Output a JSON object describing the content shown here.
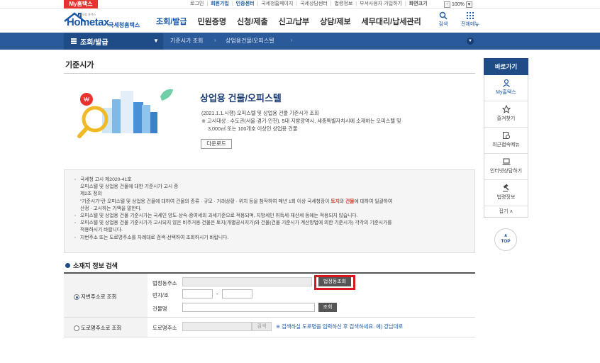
{
  "util": {
    "myhome": "My홈택스",
    "links": [
      {
        "label": "로그인",
        "highlight": false
      },
      {
        "label": "회원가입",
        "highlight": true
      },
      {
        "label": "인증센터",
        "highlight": true
      },
      {
        "label": "국세청홈페이지",
        "highlight": false
      },
      {
        "label": "국세상담센터",
        "highlight": false
      },
      {
        "label": "법령정보",
        "highlight": false
      },
      {
        "label": "부서사용자 가입하기",
        "highlight": false
      },
      {
        "label": "화면크기",
        "highlight": false
      }
    ],
    "zoom": "100%"
  },
  "header": {
    "logo_text": "Hometax",
    "logo_sub": "국세청홈택스",
    "logo_tiny": "국세청 홈택스",
    "gnb": [
      "조회/발급",
      "민원증명",
      "신청/제출",
      "신고/납부",
      "상담/제보",
      "세무대리/납세관리"
    ],
    "icons": [
      {
        "name": "search-icon",
        "label": "검색"
      },
      {
        "name": "all-menu-icon",
        "label": "전체메뉴"
      }
    ]
  },
  "nav": {
    "section": "조회/발급",
    "crumbs": [
      "기준시가 조회",
      "상업용건물/오피스텔"
    ]
  },
  "page": {
    "title": "기준시가"
  },
  "hero": {
    "title": "상업용 건물/오피스텔",
    "desc_1": "(2021.1.1.시행) 오피스텔 및 상업용 건물 기준시가 조회",
    "desc_2": "※ 고시대상 : 수도권(서울·경기·인천), 5대 지방광역시, 세종특별자치시에 소재하는 오피스텔 및",
    "desc_3": "3,000㎡ 또는 100개호 이상인 상업용 건물",
    "download": "다운로드"
  },
  "notice": {
    "lines": [
      {
        "text": "국세청 고시 제2020-41호",
        "bullet": true
      },
      {
        "text": "오피스텔 및 상업용 건물에 대한 기준시가 고시 중",
        "bullet": false
      },
      {
        "text": "제2조 정의",
        "bullet": false
      },
      {
        "text": "\"기준시가\"란 오피스텔 및 상업용 건물에 대하여 건물의 종류 · 규모 · 거래상황 · 위치 등을 참작하여 매년 1회 이상 국세청장이 토지와 건물에 대하여 일괄하여",
        "bullet": false
      },
      {
        "text": "산정 · 고시하는 가액을 말한다.",
        "bullet": false
      },
      {
        "text": "오피스텔 및 상업용 건물 기준시가는 국세인 양도·상속·증여세의 과세기준으로 적용되며, 지방세인 취득세·재산세 등에는 적용되지 않습니다.",
        "bullet": true
      },
      {
        "text": "오피스텔 및 상업용 건물 기준시가가 고시되지 않은 비주거용 건물은 토지(개별공시지가)와 건물(건물 기준시가 계산방법에 의한 기준시가) 각각의 기준시가를",
        "bullet": true
      },
      {
        "text": "적용하시기 바랍니다.",
        "bullet": false
      },
      {
        "text": "지번주소 또는 도로명주소를 차례대로 검색·선택하여 조회하시기 바랍니다.",
        "bullet": true
      }
    ],
    "kw_land": "토지",
    "kw_building": "건물"
  },
  "search": {
    "section_title": "소재지 정보 검색",
    "radio_jibun": "지번주소로 조회",
    "radio_road": "도로명주소로 조회",
    "label_legal_dong": "법정동주소",
    "label_bunji": "번지/호",
    "label_building": "건물명",
    "label_road": "도로명주소",
    "btn_legal_dong": "법정동조회",
    "btn_query": "조회",
    "btn_search": "검색",
    "dash": "-",
    "hint": "※ 검색하실 도로명을 입력하신 후 검색하세요. 예) 강남대로"
  },
  "quick": {
    "title": "바로가기",
    "items": [
      {
        "icon": "person-icon",
        "label": "My홈택스"
      },
      {
        "icon": "star-icon",
        "label": "즐겨찾기"
      },
      {
        "icon": "recent-menu-icon",
        "label": "최근접속메뉴"
      },
      {
        "icon": "laptop-icon",
        "label": "인터넷상담하기"
      },
      {
        "icon": "gavel-icon",
        "label": "법령정보"
      }
    ],
    "fold": "접기 ∧",
    "top": "TOP"
  },
  "colors": {
    "brand": "#1a5aa8",
    "nav": "#2b5a9a",
    "highlight_box": "#d8171e",
    "title_underline": "#ffe600"
  }
}
